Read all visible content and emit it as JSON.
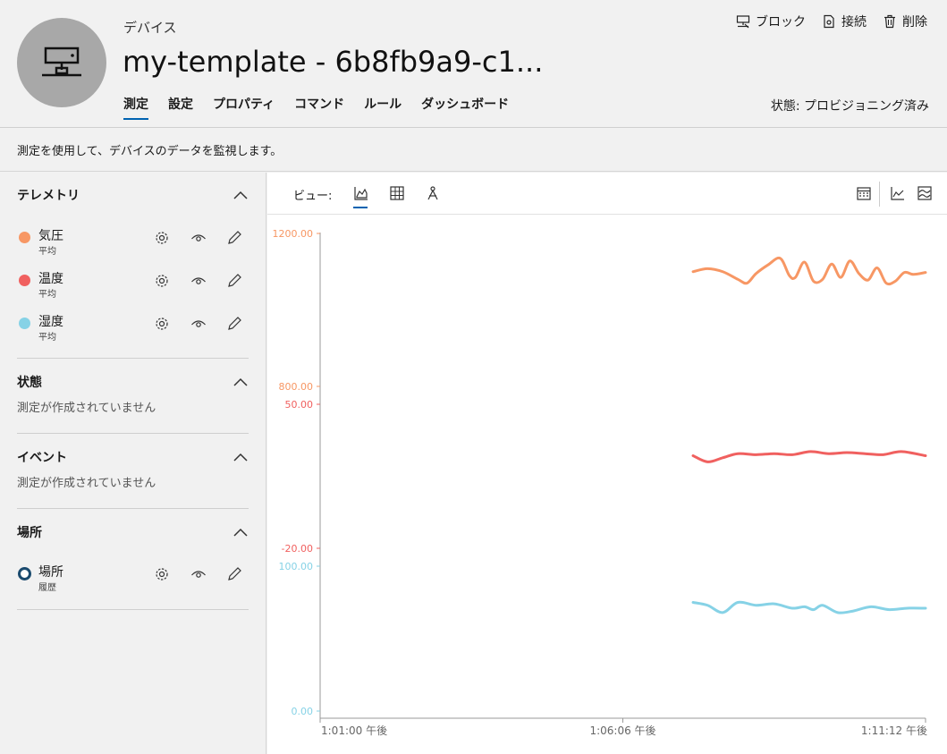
{
  "header": {
    "kind": "デバイス",
    "title": "my-template - 6b8fb9a9-c1...",
    "tabs": [
      {
        "label": "測定"
      },
      {
        "label": "設定"
      },
      {
        "label": "プロパティ"
      },
      {
        "label": "コマンド"
      },
      {
        "label": "ルール"
      },
      {
        "label": "ダッシュボード"
      }
    ],
    "actions": {
      "block": "ブロック",
      "connect": "接続",
      "delete": "削除"
    },
    "status": "状態: プロビジョニング済み"
  },
  "description": "測定を使用して、デバイスのデータを監視します。",
  "sidebar": {
    "telemetry": {
      "title": "テレメトリ",
      "items": [
        {
          "name": "気圧",
          "agg": "平均",
          "color": "#f79764"
        },
        {
          "name": "温度",
          "agg": "平均",
          "color": "#f0605f"
        },
        {
          "name": "湿度",
          "agg": "平均",
          "color": "#86d2e6"
        }
      ]
    },
    "state": {
      "title": "状態",
      "empty": "測定が作成されていません"
    },
    "events": {
      "title": "イベント",
      "empty": "測定が作成されていません"
    },
    "location": {
      "title": "場所",
      "items": [
        {
          "name": "場所",
          "agg": "履歴",
          "color": "#1a4a6e"
        }
      ]
    }
  },
  "chart": {
    "view_label": "ビュー:"
  },
  "chart_data": {
    "type": "line",
    "x_ticks": [
      "1:01:00 午後",
      "1:06:06 午後",
      "1:11:12 午後"
    ],
    "series": [
      {
        "name": "気圧",
        "color": "#f79764",
        "axis_ticks": [
          "1200.00",
          "800.00"
        ],
        "ylim": [
          800,
          1200
        ],
        "x": [
          0.616,
          0.64,
          0.665,
          0.69,
          0.705,
          0.72,
          0.74,
          0.76,
          0.775,
          0.785,
          0.8,
          0.815,
          0.83,
          0.845,
          0.86,
          0.875,
          0.89,
          0.905,
          0.92,
          0.935,
          0.95,
          0.965,
          0.98,
          1.0
        ],
        "y": [
          1100,
          1108,
          1100,
          1080,
          1070,
          1095,
          1118,
          1135,
          1090,
          1085,
          1125,
          1075,
          1080,
          1120,
          1085,
          1128,
          1095,
          1078,
          1110,
          1070,
          1075,
          1098,
          1093,
          1098
        ]
      },
      {
        "name": "温度",
        "color": "#f0605f",
        "axis_ticks": [
          "50.00",
          "-20.00"
        ],
        "ylim": [
          -20,
          50
        ],
        "x": [
          0.616,
          0.64,
          0.665,
          0.69,
          0.72,
          0.75,
          0.78,
          0.81,
          0.84,
          0.87,
          0.9,
          0.93,
          0.96,
          1.0
        ],
        "y": [
          25,
          22,
          24,
          26,
          25.5,
          26,
          25.5,
          27,
          26,
          26.5,
          26,
          25.5,
          27,
          25
        ]
      },
      {
        "name": "湿度",
        "color": "#86d2e6",
        "axis_ticks": [
          "100.00",
          "0.00"
        ],
        "ylim": [
          0,
          100
        ],
        "x": [
          0.616,
          0.64,
          0.665,
          0.69,
          0.72,
          0.75,
          0.78,
          0.8,
          0.815,
          0.83,
          0.855,
          0.88,
          0.91,
          0.94,
          0.97,
          1.0
        ],
        "y": [
          75,
          73,
          68,
          75,
          73,
          74,
          71,
          72,
          70,
          73,
          68,
          69,
          72,
          70,
          71,
          71
        ]
      }
    ]
  }
}
